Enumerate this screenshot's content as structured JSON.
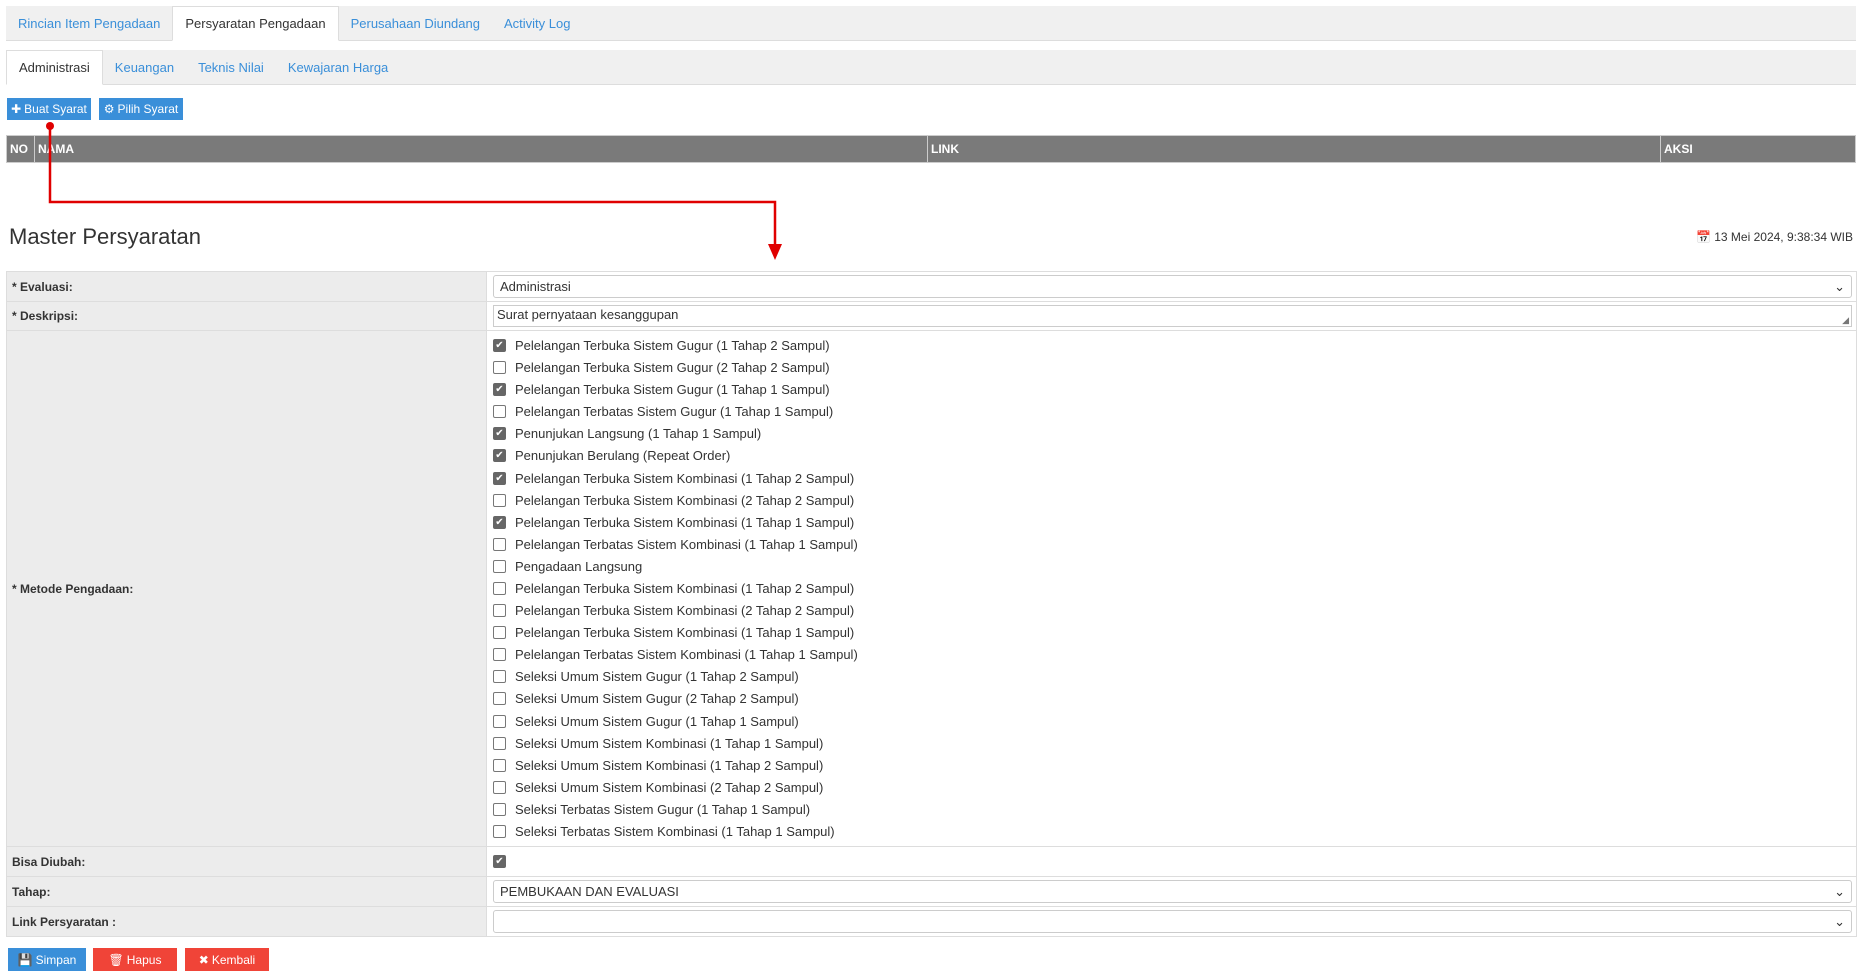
{
  "top_tabs": [
    "Rincian Item Pengadaan",
    "Persyaratan Pengadaan",
    "Perusahaan Diundang",
    "Activity Log"
  ],
  "sub_tabs": [
    "Administrasi",
    "Keuangan",
    "Teknis Nilai",
    "Kewajaran Harga"
  ],
  "buttons": {
    "buat": "Buat Syarat",
    "pilih": "Pilih Syarat",
    "simpan": "Simpan",
    "hapus": "Hapus",
    "kembali": "Kembali"
  },
  "table": {
    "headers": [
      "NO",
      "NAMA",
      "LINK",
      "AKSI"
    ]
  },
  "title": "Master Persyaratan",
  "date": "13 Mei 2024, 9:38:34 WIB",
  "form": {
    "evaluasi_label": "* Evaluasi:",
    "evaluasi_value": "Administrasi",
    "deskripsi_label": "* Deskripsi:",
    "deskripsi_value": "Surat pernyataan kesanggupan",
    "metode_label": "* Metode Pengadaan:",
    "metode": [
      {
        "label": "Pelelangan Terbuka Sistem Gugur (1 Tahap 2 Sampul)",
        "checked": true
      },
      {
        "label": "Pelelangan Terbuka Sistem Gugur (2 Tahap 2 Sampul)",
        "checked": false
      },
      {
        "label": "Pelelangan Terbuka Sistem Gugur (1 Tahap 1 Sampul)",
        "checked": true
      },
      {
        "label": "Pelelangan Terbatas Sistem Gugur (1 Tahap 1 Sampul)",
        "checked": false
      },
      {
        "label": "Penunjukan Langsung (1 Tahap 1 Sampul)",
        "checked": true
      },
      {
        "label": "Penunjukan Berulang (Repeat Order)",
        "checked": true
      },
      {
        "label": "Pelelangan Terbuka Sistem Kombinasi (1 Tahap 2 Sampul)",
        "checked": true
      },
      {
        "label": "Pelelangan Terbuka Sistem Kombinasi (2 Tahap 2 Sampul)",
        "checked": false
      },
      {
        "label": "Pelelangan Terbuka Sistem Kombinasi (1 Tahap 1 Sampul)",
        "checked": true
      },
      {
        "label": "Pelelangan Terbatas Sistem Kombinasi (1 Tahap 1 Sampul)",
        "checked": false
      },
      {
        "label": "Pengadaan Langsung",
        "checked": false
      },
      {
        "label": "Pelelangan Terbuka Sistem Kombinasi (1 Tahap 2 Sampul)",
        "checked": false
      },
      {
        "label": "Pelelangan Terbuka Sistem Kombinasi (2 Tahap 2 Sampul)",
        "checked": false
      },
      {
        "label": "Pelelangan Terbuka Sistem Kombinasi (1 Tahap 1 Sampul)",
        "checked": false
      },
      {
        "label": "Pelelangan Terbatas Sistem Kombinasi (1 Tahap 1 Sampul)",
        "checked": false
      },
      {
        "label": "Seleksi Umum Sistem Gugur (1 Tahap 2 Sampul)",
        "checked": false
      },
      {
        "label": "Seleksi Umum Sistem Gugur (2 Tahap 2 Sampul)",
        "checked": false
      },
      {
        "label": "Seleksi Umum Sistem Gugur (1 Tahap 1 Sampul)",
        "checked": false
      },
      {
        "label": "Seleksi Umum Sistem Kombinasi (1 Tahap 1 Sampul)",
        "checked": false
      },
      {
        "label": "Seleksi Umum Sistem Kombinasi (1 Tahap 2 Sampul)",
        "checked": false
      },
      {
        "label": "Seleksi Umum Sistem Kombinasi (2 Tahap 2 Sampul)",
        "checked": false
      },
      {
        "label": "Seleksi Terbatas Sistem Gugur (1 Tahap 1 Sampul)",
        "checked": false
      },
      {
        "label": "Seleksi Terbatas Sistem Kombinasi (1 Tahap 1 Sampul)",
        "checked": false
      }
    ],
    "bisa_label": "Bisa Diubah:",
    "bisa_checked": true,
    "tahap_label": "Tahap:",
    "tahap_value": "PEMBUKAAN DAN EVALUASI",
    "link_label": "Link Persyaratan :",
    "link_value": ""
  },
  "colors": {
    "accent": "#3a8fd9",
    "danger": "#f04438",
    "annotation": "#e00000"
  }
}
